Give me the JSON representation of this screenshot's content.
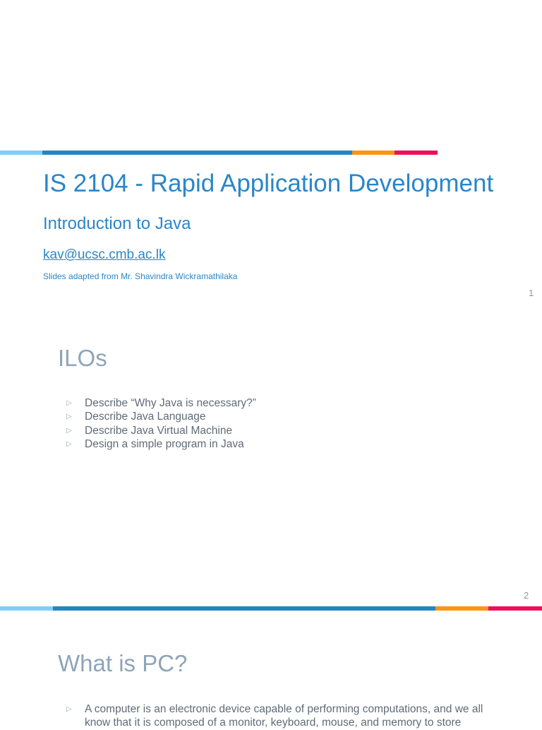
{
  "colors": {
    "light_blue": "#7fcdfb",
    "blue": "#2385c4",
    "orange": "#ff9412",
    "pink": "#f0105a"
  },
  "slide1": {
    "title": "IS 2104 - Rapid Application Development",
    "subtitle": "Introduction to Java",
    "email": "kav@ucsc.cmb.ac.lk",
    "credit": "Slides adapted from Mr. Shavindra Wickramathilaka",
    "page_number": "1"
  },
  "slide2": {
    "heading": "ILOs",
    "bullet_icon": "triangle-right-outline",
    "bullets": [
      "Describe “Why Java is necessary?”",
      "Describe Java Language",
      "Describe Java Virtual Machine",
      "Design a simple program in Java"
    ],
    "page_number": "2"
  },
  "slide3": {
    "heading": "What is PC?",
    "bullets": [
      "A computer is an electronic device capable of performing computations, and we all",
      "know that it is composed of a monitor, keyboard, mouse, and memory to store"
    ]
  }
}
